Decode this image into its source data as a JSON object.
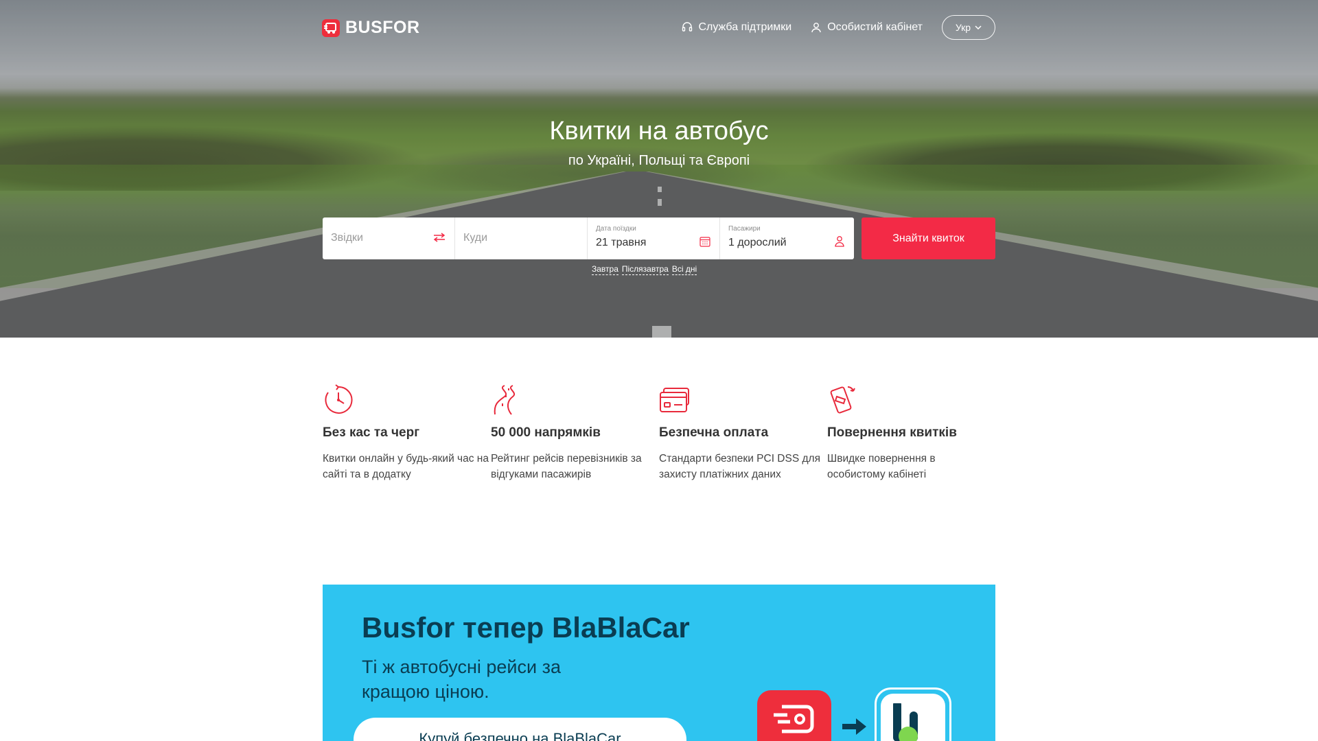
{
  "header": {
    "brand": "BUSFOR",
    "support_label": "Служба підтримки",
    "account_label": "Особистий кабінет",
    "lang_label": "Укр"
  },
  "hero": {
    "title": "Квитки на автобус",
    "subtitle": "по Україні, Польщі та Європі"
  },
  "search": {
    "from_placeholder": "Звідки",
    "to_placeholder": "Куди",
    "date_label": "Дата поїздки",
    "date_value": "21 травня",
    "passengers_label": "Пасажири",
    "passengers_value": "1 дорослий",
    "button_label": "Знайти квиток",
    "quick_dates": [
      "Завтра",
      "Післязавтра",
      "Всі дні"
    ]
  },
  "features": [
    {
      "icon": "clock-icon",
      "title": "Без кас та черг",
      "text": "Квитки онлайн у будь-який час на сайті та в додатку"
    },
    {
      "icon": "route-icon",
      "title": "50 000 напрямків",
      "text": "Рейтинг рейсів перевізників за відгуками пасажирів"
    },
    {
      "icon": "card-icon",
      "title": "Безпечна оплата",
      "text": "Стандарти безпеки PCI DSS для захисту платіжних даних"
    },
    {
      "icon": "phone-refund-icon",
      "title": "Повернення квитків",
      "text": "Швидке повернення в особистому кабінеті"
    }
  ],
  "promo": {
    "title": "Busfor тепер BlaBlaCar",
    "subtitle": "Ті ж автобусні рейси за кращою ціною.",
    "button_label": "Купуй  безпечно на BlaBlaCar"
  },
  "colors": {
    "accent": "#f32a46",
    "promo_bg": "#2ec4f0",
    "promo_text": "#0a3d52"
  }
}
